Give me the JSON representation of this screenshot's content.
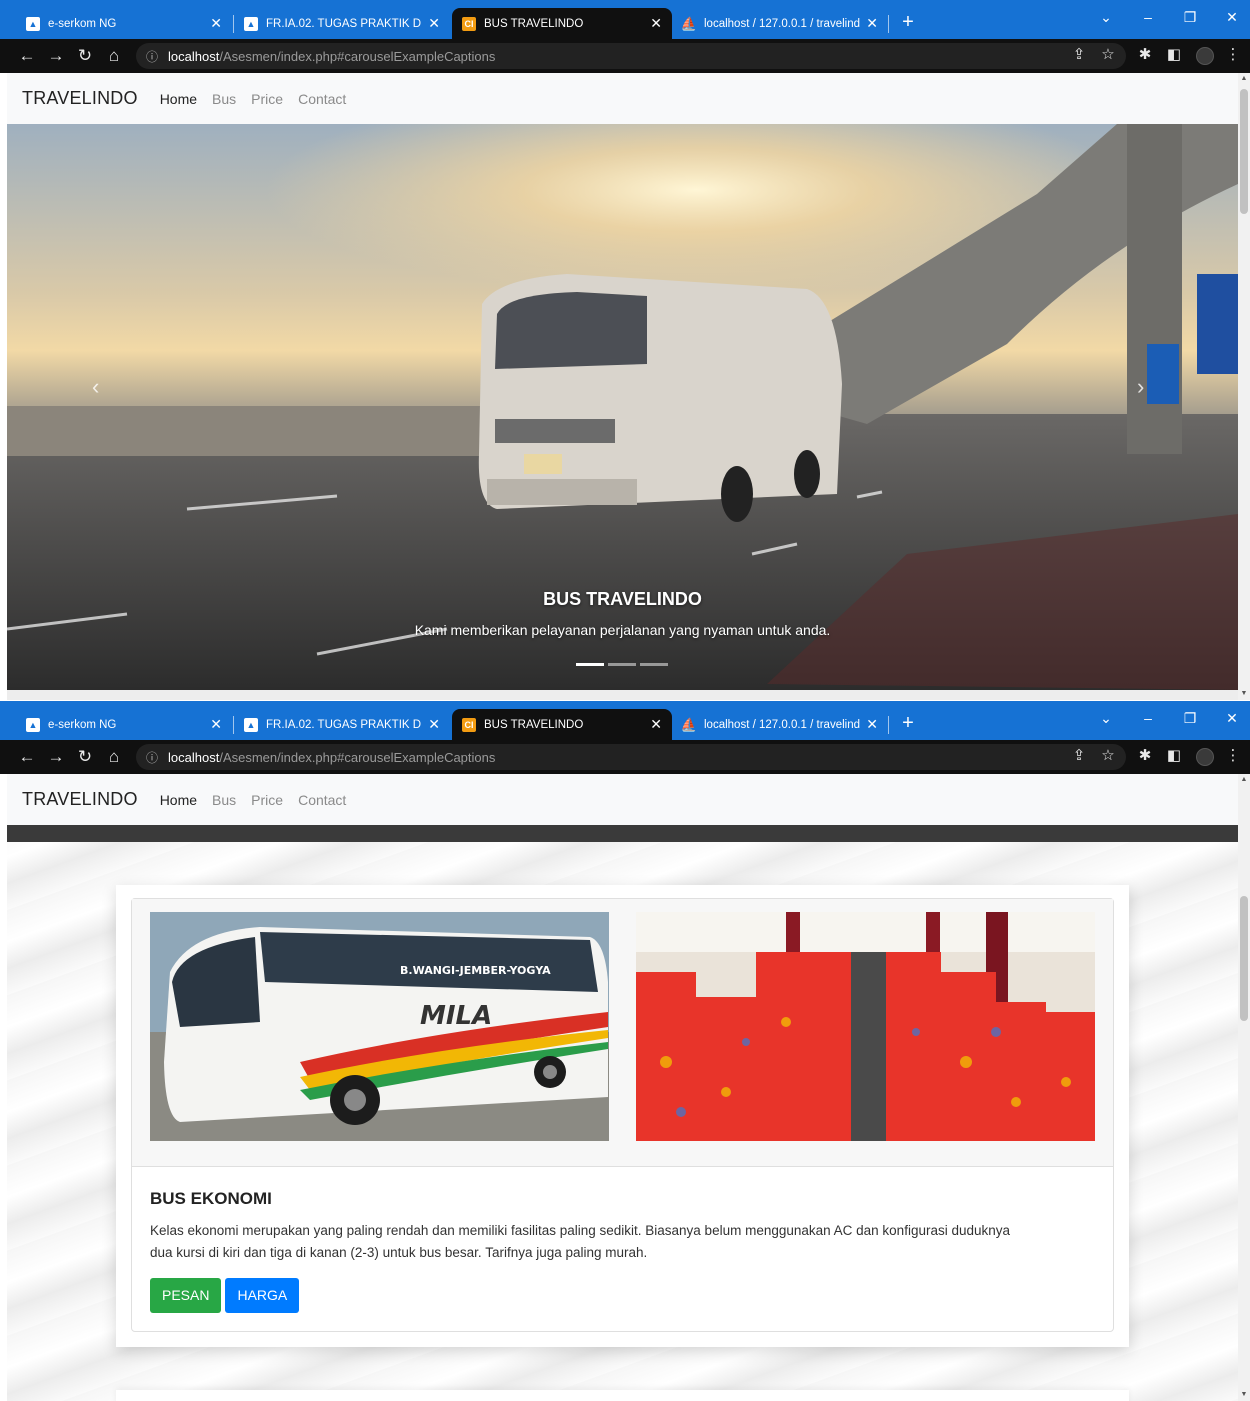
{
  "browser": {
    "tabs": [
      {
        "title": "e-serkom NG",
        "icon": "blue-logo-icon"
      },
      {
        "title": "FR.IA.02. TUGAS PRAKTIK DEMON",
        "icon": "blue-logo-icon"
      },
      {
        "title": "BUS TRAVELINDO",
        "icon": "orange-logo-icon",
        "active": true
      },
      {
        "title": "localhost / 127.0.0.1 / travelindo",
        "icon": "phpmyadmin-icon"
      }
    ],
    "new_tab": "+",
    "url_host": "localhost",
    "url_path": "/Asesmen/index.php#carouselExampleCaptions"
  },
  "navbar": {
    "brand": "TRAVELINDO",
    "links": [
      "Home",
      "Bus",
      "Price",
      "Contact"
    ]
  },
  "carousel": {
    "title": "BUS TRAVELINDO",
    "text": "Kami memberikan pelayanan perjalanan yang nyaman untuk anda.",
    "indicators": 3,
    "active_index": 0,
    "prev": "‹",
    "next": "›"
  },
  "card": {
    "bus_livery": "MILA",
    "bus_route": "B.WANGI-JEMBER-YOGYA",
    "title": "BUS EKONOMI",
    "text_line1": "Kelas ekonomi merupakan yang paling rendah dan memiliki fasilitas paling sedikit. Biasanya belum menggunakan AC dan konfigurasi duduknya",
    "text_line2": "dua kursi di kiri dan tiga di kanan (2-3) untuk bus besar. Tarifnya juga paling murah.",
    "btn_order": "PESAN",
    "btn_price": "HARGA"
  },
  "colors": {
    "tabstrip": "#1672d4",
    "toolbar": "#101010",
    "green": "#28a745",
    "blue": "#007bff"
  }
}
